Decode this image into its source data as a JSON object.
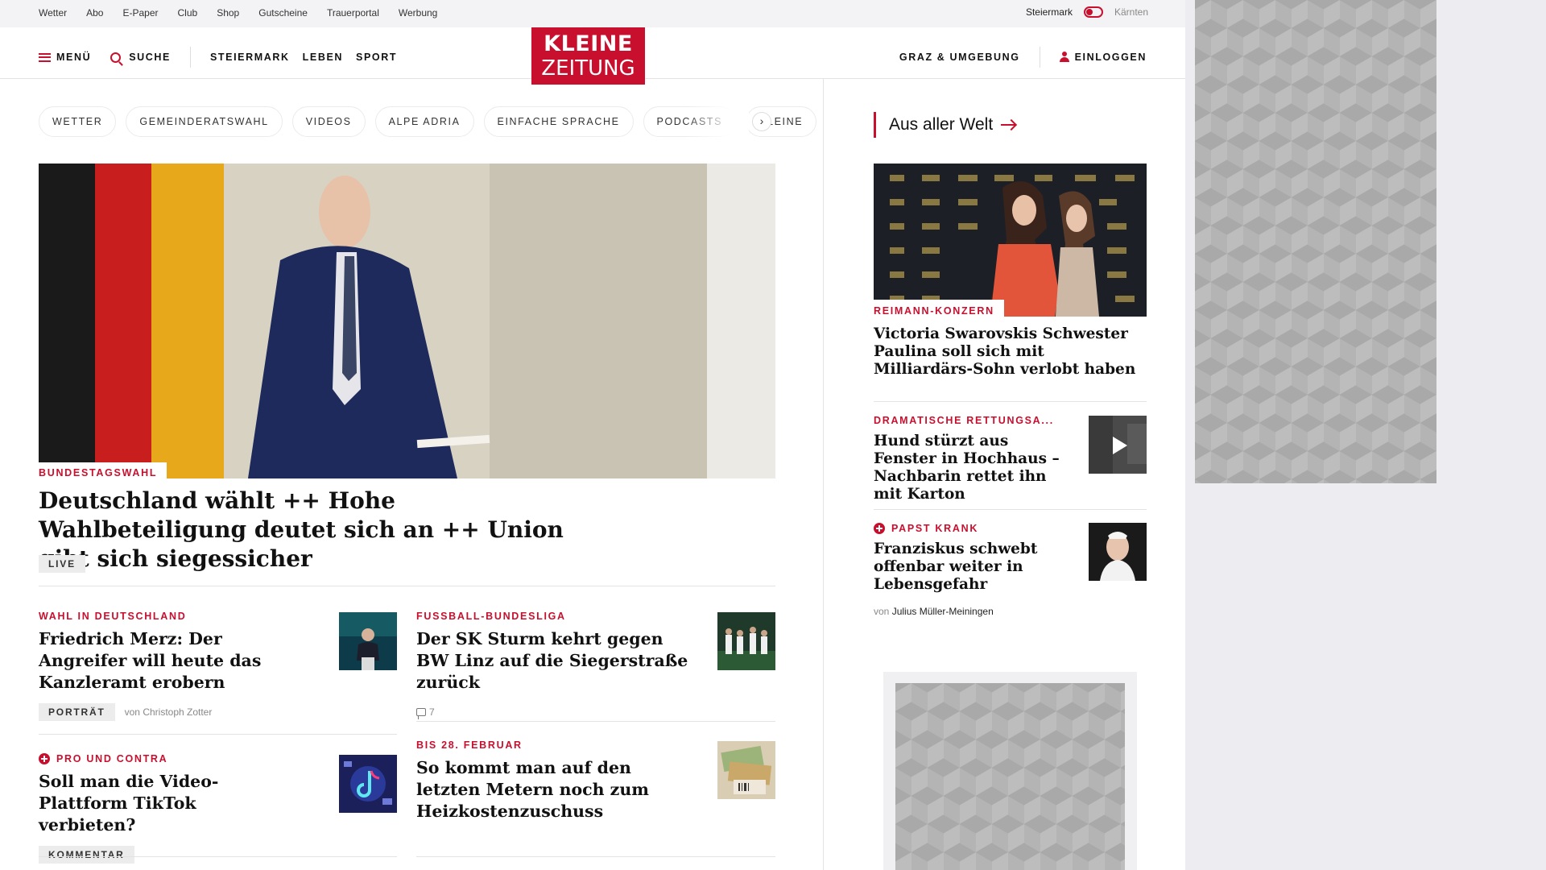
{
  "topbar": {
    "links": [
      "Wetter",
      "Abo",
      "E-Paper",
      "Club",
      "Shop",
      "Gutscheine",
      "Trauerportal",
      "Werbung"
    ],
    "region_active": "Steiermark",
    "region_other": "Kärnten"
  },
  "header": {
    "menu_label": "MENÜ",
    "search_label": "SUCHE",
    "sections": [
      "STEIERMARK",
      "LEBEN",
      "SPORT"
    ],
    "logo_line1": "KLEINE",
    "logo_line2": "ZEITUNG",
    "region_label": "GRAZ & UMGEBUNG",
    "login_label": "EINLOGGEN"
  },
  "chips": [
    "WETTER",
    "GEMEINDERATSWAHL",
    "VIDEOS",
    "ALPE ADRIA",
    "EINFACHE SPRACHE",
    "PODCASTS",
    "KLEINE"
  ],
  "hero": {
    "kicker": "BUNDESTAGSWAHL",
    "title": "Deutschland wählt ++ Hohe Wahlbeteiligung deutet sich an ++ Union gibt sich siegessicher",
    "tag": "LIVE"
  },
  "teasers": [
    {
      "kicker": "WAHL IN DEUTSCHLAND",
      "title": "Friedrich Merz: Der Angreifer will heute das Kanzleramt erobern",
      "tag": "PORTRÄT",
      "author_prefix": "von",
      "author": "Christoph Zotter"
    },
    {
      "kicker": "FUSSBALL-BUNDESLIGA",
      "title": "Der SK Sturm kehrt gegen BW Linz auf die Siegerstraße zurück",
      "comments": "7"
    },
    {
      "kicker": "PRO UND CONTRA",
      "title": "Soll man die Video-Plattform TikTok verbieten?",
      "tag": "KOMMENTAR"
    },
    {
      "kicker": "BIS 28. FEBRUAR",
      "title": "So kommt man auf den letzten Metern noch zum Heizkostenzuschuss"
    }
  ],
  "sidebar": {
    "heading": "Aus aller Welt",
    "main": {
      "kicker": "REIMANN-KONZERN",
      "title": "Victoria Swarovskis Schwester Paulina soll sich mit Milliardärs-Sohn verlobt haben"
    },
    "items": [
      {
        "kicker": "DRAMATISCHE RETTUNGSA...",
        "title": "Hund stürzt aus Fenster in Hochhaus – Nachbarin rettet ihn mit Karton"
      },
      {
        "kicker": "PAPST KRANK",
        "title": "Franziskus schwebt offenbar weiter in Lebensgefahr",
        "author_prefix": "von",
        "author": "Julius Müller-Meiningen"
      }
    ]
  },
  "colors": {
    "brand": "#c8102e",
    "background": "#ececf1"
  }
}
